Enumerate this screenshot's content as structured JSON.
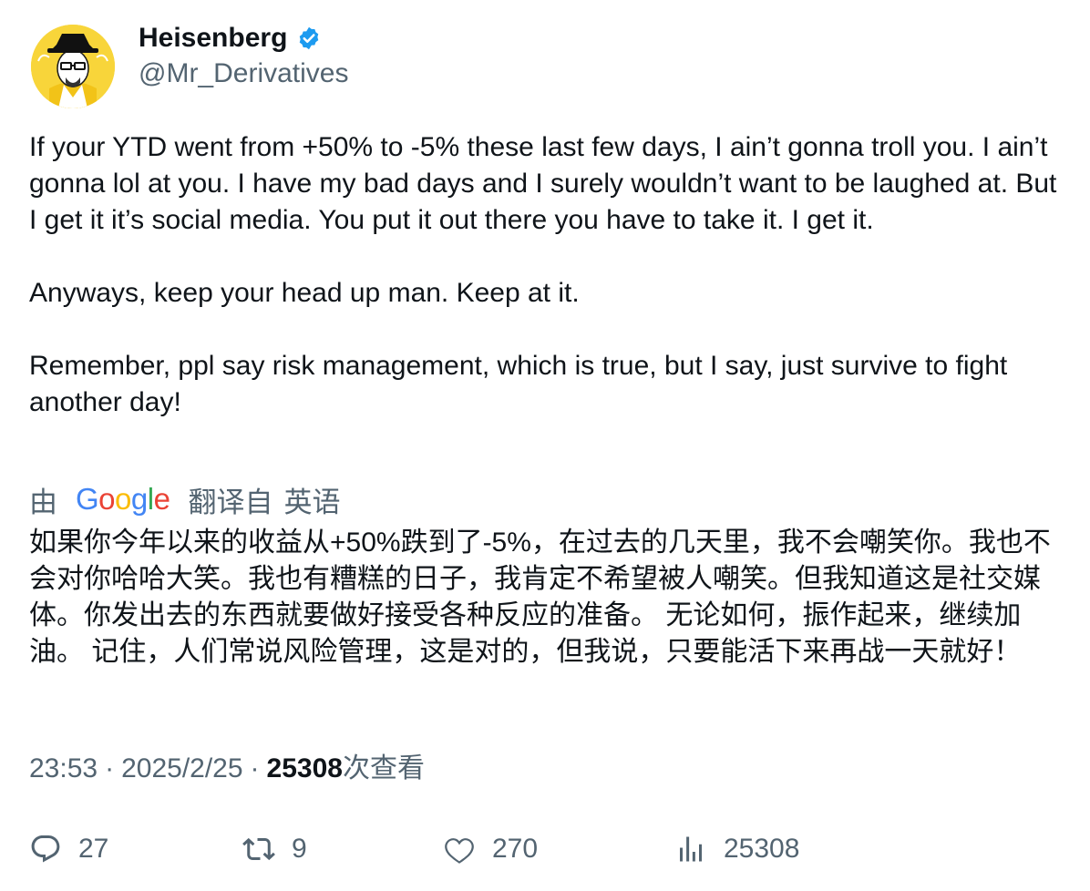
{
  "author": {
    "display_name": "Heisenberg",
    "handle": "@Mr_Derivatives",
    "verified_color": "#1d9bf0"
  },
  "tweet": {
    "paragraphs": [
      "If your YTD went from +50% to -5% these last few days, I ain’t gonna troll you. I ain’t gonna lol at you. I have my bad days and I surely wouldn’t want to be laughed at. But I get it it’s social media. You put it out there you have to take it. I get it.",
      "Anyways, keep your head up man. Keep at it.",
      "Remember, ppl say risk management, which is true, but I say, just survive to fight another day!"
    ]
  },
  "translation": {
    "by_label": "由",
    "provider": "Google",
    "from_label": "翻译自",
    "language": "英语",
    "text": "如果你今年以来的收益从+50%跌到了-5%，在过去的几天里，我不会嘲笑你。我也不会对你哈哈大笑。我也有糟糕的日子，我肯定不希望被人嘲笑。但我知道这是社交媒体。你发出去的东西就要做好接受各种反应的准备。 无论如何，振作起来，继续加油。 记住，人们常说风险管理，这是对的，但我说，只要能活下来再战一天就好！"
  },
  "meta": {
    "time": "23:53",
    "separator": "·",
    "date": "2025/2/25",
    "views_count": "25308",
    "views_label": "次查看"
  },
  "actions": {
    "replies": "27",
    "reposts": "9",
    "likes": "270",
    "views": "25308"
  },
  "colors": {
    "text_primary": "#0f1419",
    "text_secondary": "#536471",
    "avatar_bg": "#f8d53a"
  },
  "icons": [
    "verified-badge-icon",
    "reply-icon",
    "repost-icon",
    "like-icon",
    "views-chart-icon"
  ]
}
